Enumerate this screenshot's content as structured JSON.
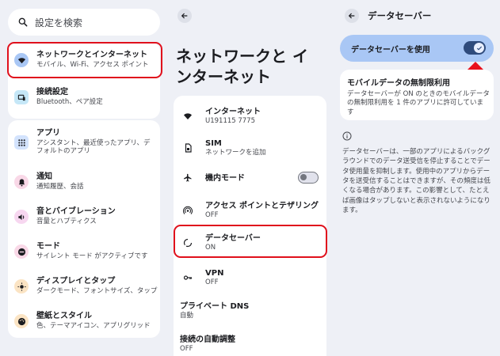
{
  "search": {
    "placeholder": "設定を検索",
    "icon": "search-icon"
  },
  "left_nav": {
    "group1": [
      {
        "title": "ネットワークとインターネット",
        "subtitle": "モバイル、Wi-Fi、アクセス ポイント",
        "icon": "wifi-icon",
        "selected": true
      },
      {
        "title": "接続設定",
        "subtitle": "Bluetooth、ペア設定",
        "icon": "connected-devices-icon"
      }
    ],
    "group2": [
      {
        "title": "アプリ",
        "subtitle": "アシスタント、最近使ったアプリ、デフォルトのアプリ",
        "icon": "apps-grid-icon"
      },
      {
        "title": "通知",
        "subtitle": "通知履歴、会話",
        "icon": "bell-icon"
      },
      {
        "title": "音とバイブレーション",
        "subtitle": "音量とハプティクス",
        "icon": "volume-icon"
      },
      {
        "title": "モード",
        "subtitle": "サイレント モード がアクティブです",
        "icon": "do-not-disturb-icon"
      },
      {
        "title": "ディスプレイとタップ",
        "subtitle": "ダークモード、フォントサイズ、タップ",
        "icon": "brightness-icon"
      },
      {
        "title": "壁紙とスタイル",
        "subtitle": "色、テーマアイコン、アプリグリッド",
        "icon": "palette-icon"
      }
    ]
  },
  "middle": {
    "title": "ネットワークと インターネット",
    "items": [
      {
        "title": "インターネット",
        "subtitle": "U191115 7775",
        "icon": "wifi-icon"
      },
      {
        "title": "SIM",
        "subtitle": "ネットワークを追加",
        "icon": "sim-icon"
      },
      {
        "title": "機内モード",
        "subtitle": "",
        "icon": "airplane-icon",
        "toggle": "off"
      },
      {
        "title": "アクセス ポイントとテザリング",
        "subtitle": "OFF",
        "icon": "hotspot-icon"
      },
      {
        "title": "データセーバー",
        "subtitle": "ON",
        "icon": "data-saver-icon",
        "selected": true
      },
      {
        "title": "VPN",
        "subtitle": "OFF",
        "icon": "vpn-key-icon"
      },
      {
        "title": "プライベート DNS",
        "subtitle": "自動",
        "icon": ""
      },
      {
        "title": "接続の自動調整",
        "subtitle": "OFF",
        "icon": ""
      }
    ]
  },
  "right": {
    "title": "データセーバー",
    "use_label": "データセーバーを使用",
    "use_toggle": "on",
    "unlimited_title": "モバイルデータの無制限利用",
    "unlimited_desc": "データセーバーが ON のときのモバイルデータの無制限利用を 1 件のアプリに許可しています",
    "description": "データセーバーは、一部のアプリによるバックグラウンドでのデータ送受信を停止することでデータ使用量を抑制します。使用中のアプリからデータを送受信することはできますが、その頻度は低くなる場合があります。この影響として、たとえば画像はタップしないと表示されないようになります。"
  },
  "colors": {
    "background": "#eef0f6",
    "card": "#ffffff",
    "accent_bar": "#a9c7f5",
    "toggle_on": "#2f4b7c",
    "highlight": "#e0101c",
    "selected_bg": "#dfe8fb"
  }
}
